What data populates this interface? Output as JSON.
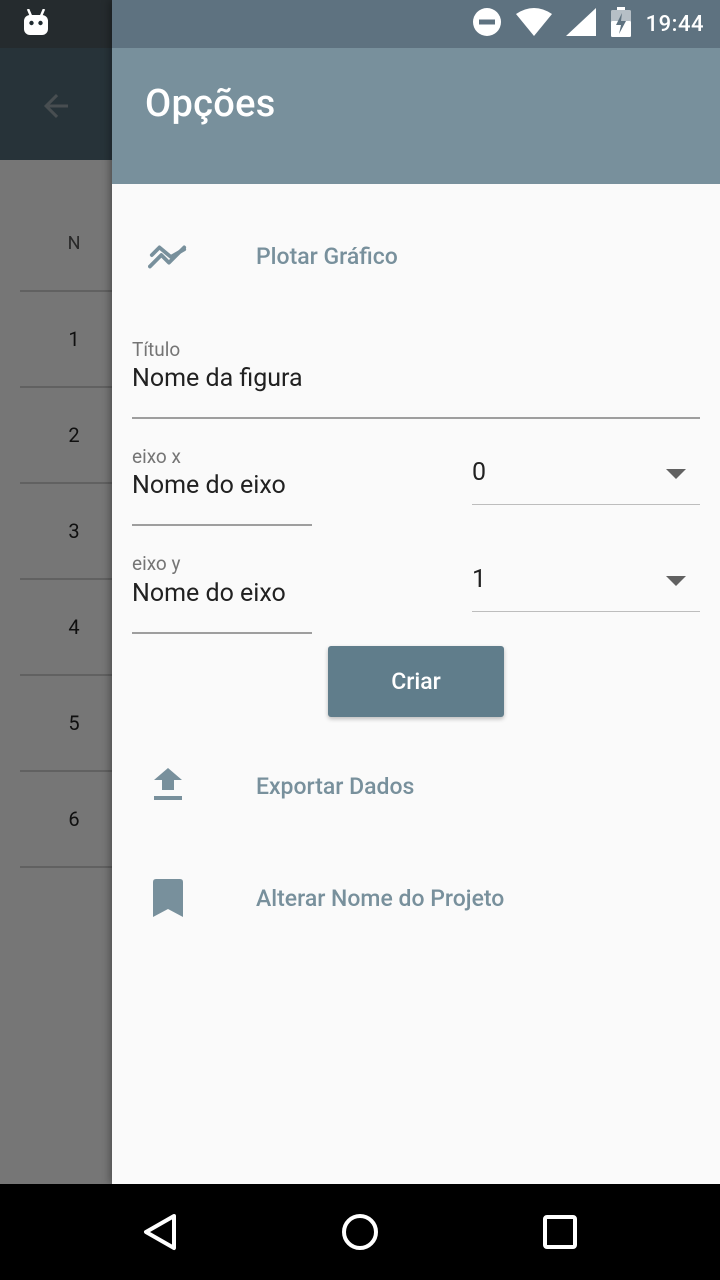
{
  "status_bar": {
    "time": "19:44",
    "icons": [
      "android-icon",
      "do-not-disturb-icon",
      "wifi-icon",
      "cell-signal-icon",
      "battery-charging-icon"
    ]
  },
  "background_app": {
    "table_header": "N",
    "rows": [
      "1",
      "2",
      "3",
      "4",
      "5",
      "6"
    ]
  },
  "drawer": {
    "title": "Opções",
    "plot_item": {
      "label": "Plotar Gráfico",
      "icon": "trending-chart-icon"
    },
    "title_field": {
      "label": "Título",
      "value": "Nome da figura"
    },
    "x_axis": {
      "label": "eixo x",
      "value": "Nome do eixo",
      "selected": "0"
    },
    "y_axis": {
      "label": "eixo y",
      "value": "Nome do eixo",
      "selected": "1"
    },
    "create_button": "Criar",
    "export_item": {
      "label": "Exportar Dados",
      "icon": "upload-icon"
    },
    "rename_item": {
      "label": "Alterar Nome do Projeto",
      "icon": "bookmark-icon"
    }
  },
  "colors": {
    "drawer_header": "#78909c",
    "accent_text": "#78909c",
    "button": "#607d8b"
  },
  "nav_bar": [
    "back-icon",
    "home-icon",
    "recents-icon"
  ]
}
